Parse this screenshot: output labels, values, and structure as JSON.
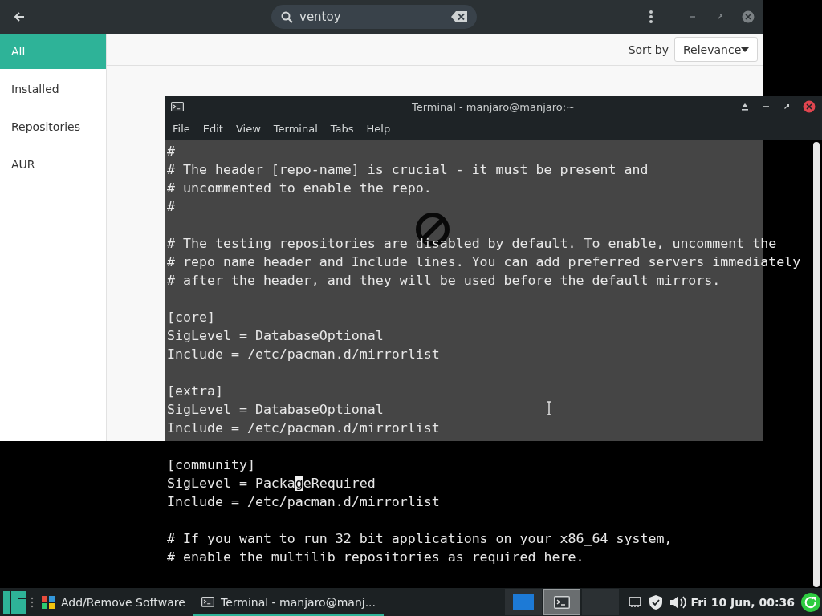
{
  "software_window": {
    "search": {
      "value": "ventoy"
    },
    "sidebar": {
      "items": [
        {
          "label": "All",
          "selected": true
        },
        {
          "label": "Installed",
          "selected": false
        },
        {
          "label": "Repositories",
          "selected": false
        },
        {
          "label": "AUR",
          "selected": false
        }
      ]
    },
    "sort": {
      "label": "Sort by",
      "value": "Relevance"
    }
  },
  "terminal": {
    "title": "Terminal - manjaro@manjaro:~",
    "menu": [
      "File",
      "Edit",
      "View",
      "Terminal",
      "Tabs",
      "Help"
    ],
    "lines": [
      {
        "kind": "text",
        "text": "#"
      },
      {
        "kind": "text",
        "text": "# The header [repo-name] is crucial - it must be present and"
      },
      {
        "kind": "text",
        "text": "# uncommented to enable the repo."
      },
      {
        "kind": "text",
        "text": "#"
      },
      {
        "kind": "blank"
      },
      {
        "kind": "text",
        "text": "# The testing repositories are disabled by default. To enable, uncomment the"
      },
      {
        "kind": "text",
        "text": "# repo name header and Include lines. You can add preferred servers immediately"
      },
      {
        "kind": "text",
        "text": "# after the header, and they will be used before the default mirrors."
      },
      {
        "kind": "blank"
      },
      {
        "kind": "text",
        "text": "[core]"
      },
      {
        "kind": "text",
        "text": "SigLevel = DatabaseOptional"
      },
      {
        "kind": "text",
        "text": "Include = /etc/pacman.d/mirrorlist"
      },
      {
        "kind": "blank"
      },
      {
        "kind": "text",
        "text": "[extra]"
      },
      {
        "kind": "text",
        "text": "SigLevel = DatabaseOptional"
      },
      {
        "kind": "text",
        "text": "Include = /etc/pacman.d/mirrorlist"
      },
      {
        "kind": "blank"
      },
      {
        "kind": "text",
        "text": "[community]"
      },
      {
        "kind": "cursor",
        "text": "SigLevel = Packa",
        "cursor": "g",
        "rest": "eRequired"
      },
      {
        "kind": "text",
        "text": "Include = /etc/pacman.d/mirrorlist"
      },
      {
        "kind": "blank"
      },
      {
        "kind": "text",
        "text": "# If you want to run 32 bit applications on your x86_64 system,"
      },
      {
        "kind": "text",
        "text": "# enable the multilib repositories as required here."
      }
    ]
  },
  "taskbar": {
    "tasks": [
      {
        "kind": "software",
        "label": "Add/Remove Software",
        "selected": false
      },
      {
        "kind": "terminal",
        "label": "Terminal - manjaro@manj...",
        "selected": true
      }
    ],
    "workspaces": [
      {
        "kind": "blue",
        "selected": false
      },
      {
        "kind": "terminal",
        "selected": true
      },
      {
        "kind": "empty",
        "selected": false
      }
    ],
    "clock": "Fri 10 Jun, 00:36"
  }
}
